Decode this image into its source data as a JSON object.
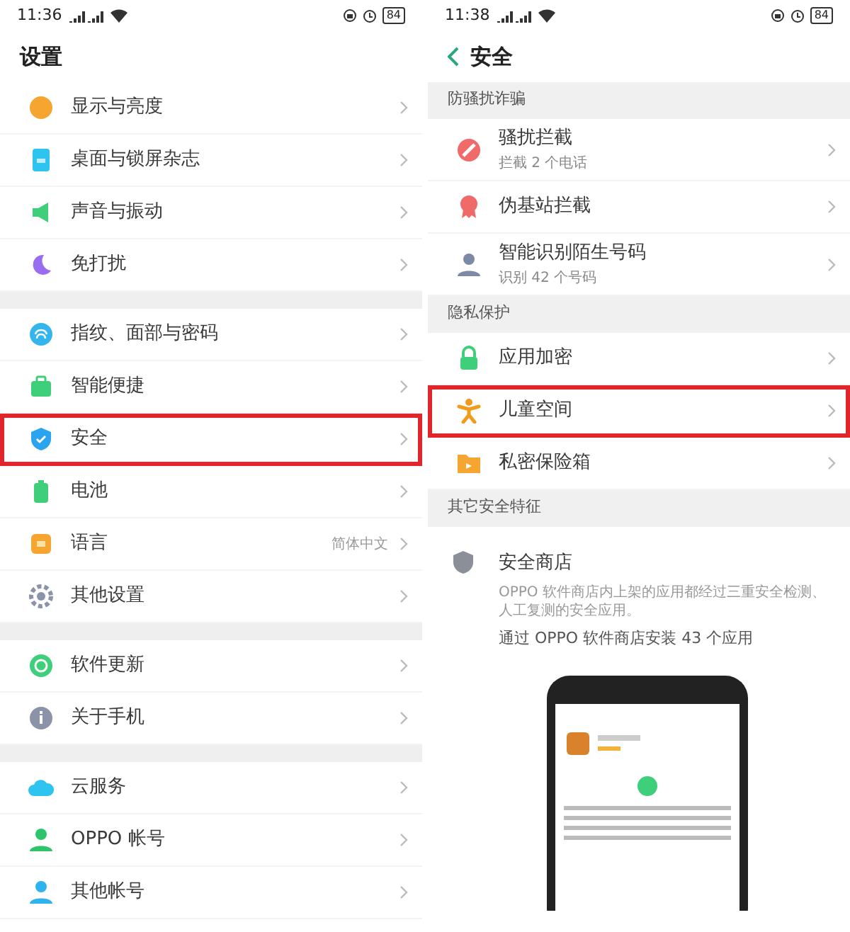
{
  "screens": [
    {
      "status": {
        "time": "11:36",
        "battery": "84"
      },
      "title": "设置",
      "back": false,
      "groups": [
        {
          "items": [
            {
              "label": "显示与亮度",
              "highlighted": false
            },
            {
              "label": "桌面与锁屏杂志",
              "highlighted": false
            },
            {
              "label": "声音与振动",
              "highlighted": false
            },
            {
              "label": "免打扰",
              "highlighted": false
            }
          ]
        },
        {
          "items": [
            {
              "label": "指纹、面部与密码",
              "highlighted": false
            },
            {
              "label": "智能便捷",
              "highlighted": false
            },
            {
              "label": "安全",
              "highlighted": true
            },
            {
              "label": "电池",
              "highlighted": false
            },
            {
              "label": "语言",
              "value": "简体中文",
              "highlighted": false
            },
            {
              "label": "其他设置",
              "highlighted": false
            }
          ]
        },
        {
          "items": [
            {
              "label": "软件更新",
              "highlighted": false
            },
            {
              "label": "关于手机",
              "highlighted": false
            }
          ]
        },
        {
          "items": [
            {
              "label": "云服务",
              "highlighted": false
            },
            {
              "label": "OPPO 帐号",
              "highlighted": false
            },
            {
              "label": "其他帐号",
              "highlighted": false
            }
          ]
        }
      ]
    },
    {
      "status": {
        "time": "11:38",
        "battery": "84"
      },
      "title": "安全",
      "back": true,
      "groups": [
        {
          "header": "防骚扰诈骗",
          "items": [
            {
              "label": "骚扰拦截",
              "sublabel": "拦截 2 个电话",
              "highlighted": false
            },
            {
              "label": "伪基站拦截",
              "highlighted": false
            },
            {
              "label": "智能识别陌生号码",
              "sublabel": "识别 42 个号码",
              "highlighted": false
            }
          ]
        },
        {
          "header": "隐私保护",
          "items": [
            {
              "label": "应用加密",
              "highlighted": false
            },
            {
              "label": "儿童空间",
              "highlighted": true
            },
            {
              "label": "私密保险箱",
              "highlighted": false
            }
          ]
        },
        {
          "header": "其它安全特征",
          "feature": {
            "title": "安全商店",
            "description": "OPPO 软件商店内上架的应用都经过三重安全检测、人工复测的安全应用。",
            "summary": "通过 OPPO 软件商店安装 43 个应用"
          }
        }
      ]
    }
  ]
}
